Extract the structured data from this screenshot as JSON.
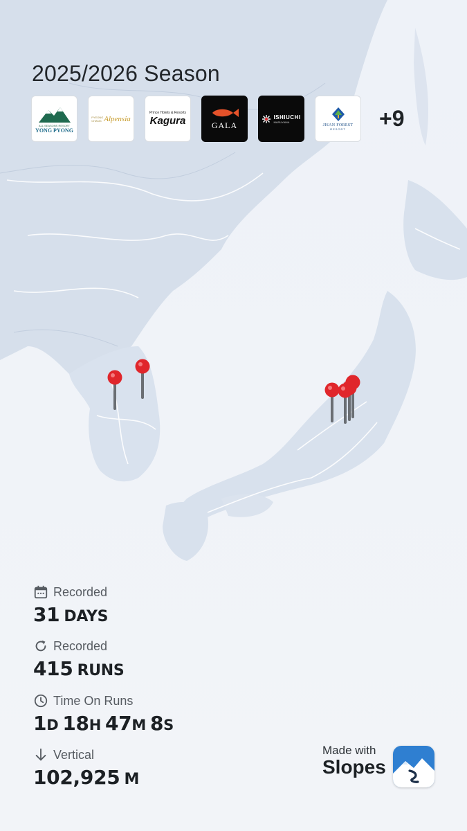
{
  "season": {
    "title": "2025/2026 Season"
  },
  "resorts": [
    {
      "name": "Yong Pyong",
      "top": "ALL SEASONS RESORT",
      "label": "YONG PYONG",
      "style": "light"
    },
    {
      "name": "Alpensia",
      "small": "PYEONG CHANG",
      "label": "Alpensia",
      "style": "light"
    },
    {
      "name": "Kagura",
      "small": "Prince Hotels & Resorts",
      "label": "Kagura",
      "style": "light"
    },
    {
      "name": "GALA",
      "label": "GALA",
      "style": "dark"
    },
    {
      "name": "Ishiuchi",
      "label": "ISHIUCHI",
      "small": "MARUYAMA",
      "style": "dark"
    },
    {
      "name": "Jisan Forest",
      "label": "JISAN FOREST",
      "small": "RESORT",
      "style": "light"
    }
  ],
  "resorts_more": "+9",
  "stats": {
    "days": {
      "label": "Recorded",
      "value": "31",
      "unit": "DAYS",
      "icon": "calendar-icon"
    },
    "runs": {
      "label": "Recorded",
      "value": "415",
      "unit": "RUNS",
      "icon": "refresh-icon"
    },
    "time": {
      "label": "Time On Runs",
      "d": "1",
      "du": "D",
      "h": "18",
      "hu": "H",
      "m": "47",
      "mu": "M",
      "s": "8",
      "su": "S",
      "icon": "clock-icon"
    },
    "vertical": {
      "label": "Vertical",
      "value": "102,925",
      "unit": "M",
      "icon": "arrow-down-icon"
    }
  },
  "branding": {
    "made_with": "Made with",
    "app": "Slopes"
  },
  "colors": {
    "pin": "#e0262b",
    "map_land": "#d7e0ec",
    "map_water": "#eef2f7"
  }
}
